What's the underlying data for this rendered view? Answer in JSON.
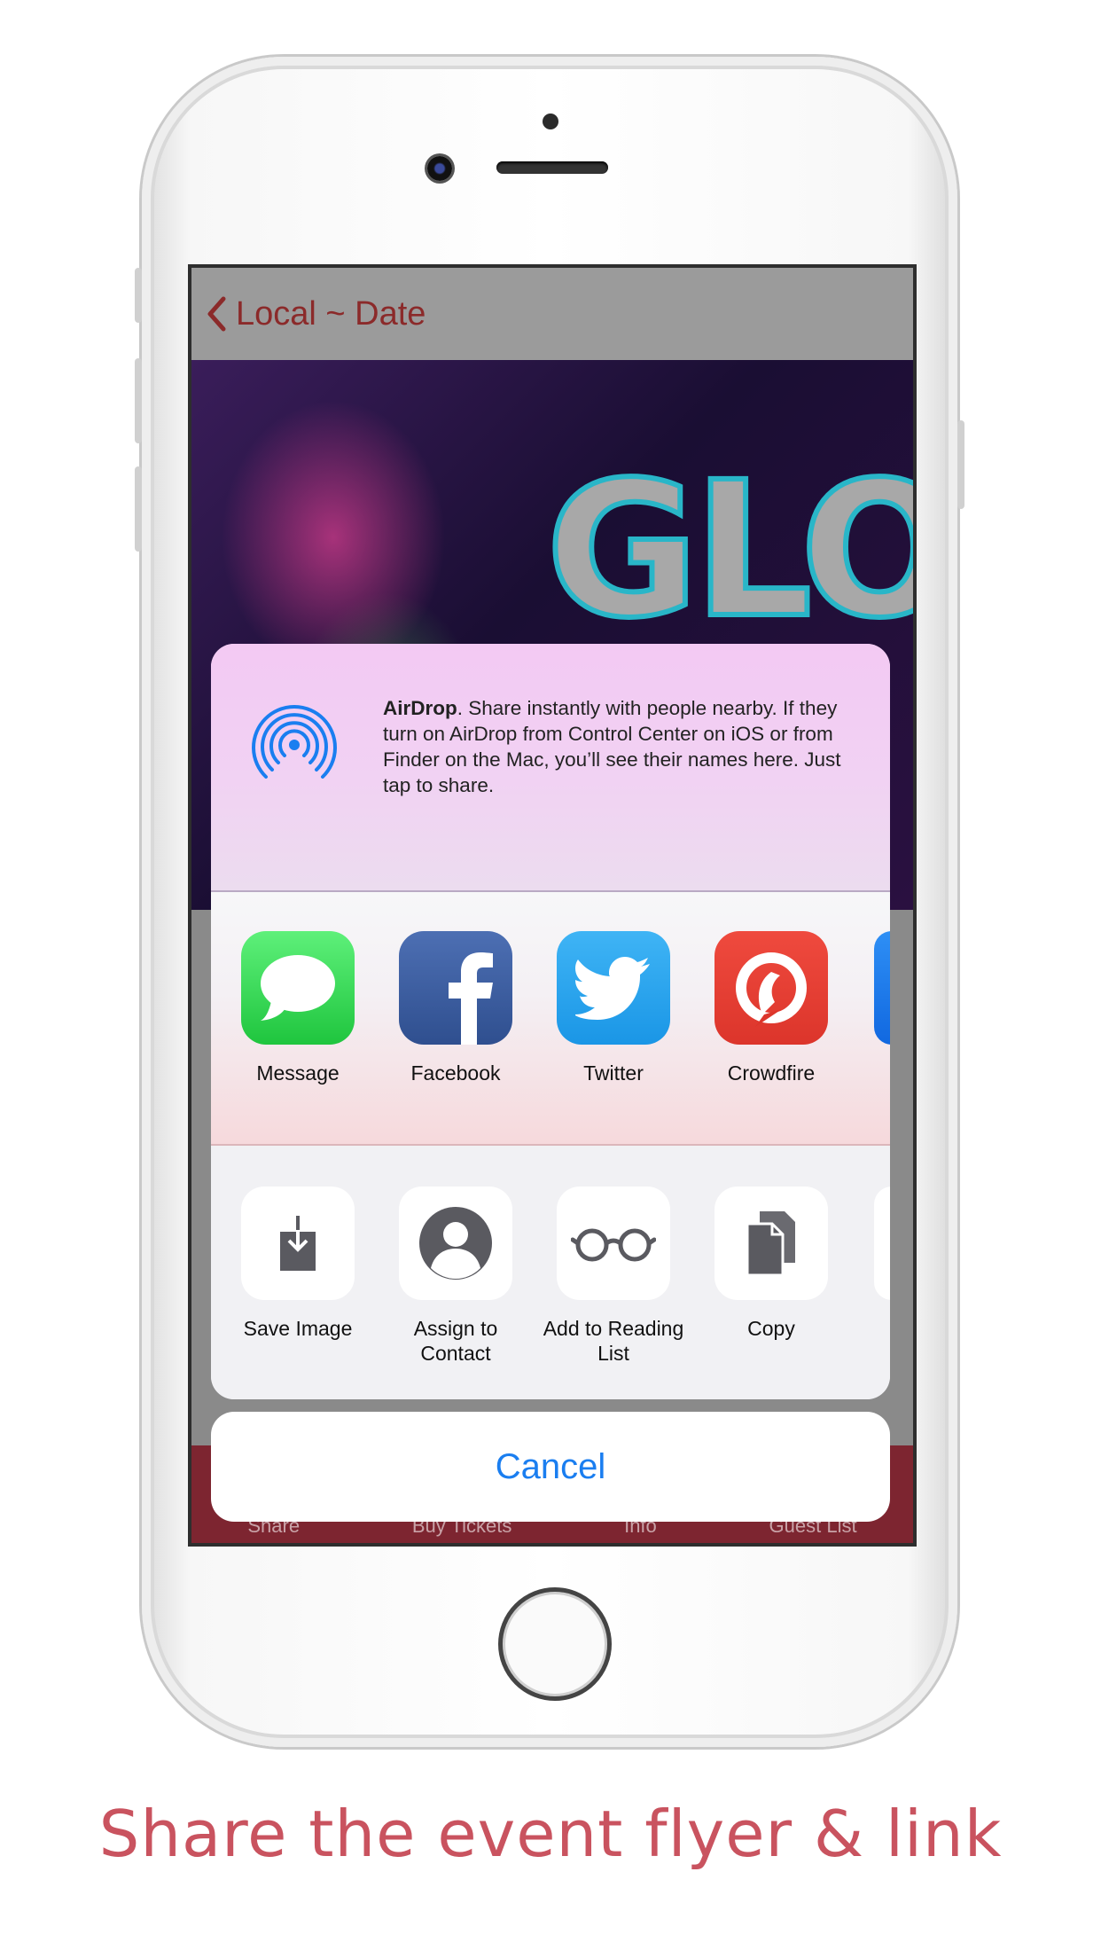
{
  "nav": {
    "back_label": "Local ~ Date"
  },
  "flyer": {
    "title": "GLOW"
  },
  "airdrop": {
    "title": "AirDrop",
    "description": ". Share instantly with people nearby. If they turn on AirDrop from Control Center on iOS or from Finder on the Mac, you’ll see their names here. Just tap to share."
  },
  "apps": [
    {
      "label": "Message",
      "color": "#34c759",
      "icon": "message-icon"
    },
    {
      "label": "Facebook",
      "color": "#3b5998",
      "icon": "facebook-icon"
    },
    {
      "label": "Twitter",
      "color": "#1da1f2",
      "icon": "twitter-icon"
    },
    {
      "label": "Crowdfire",
      "color": "#e8423a",
      "icon": "crowdfire-icon"
    }
  ],
  "actions": [
    {
      "label": "Save Image",
      "icon": "save-image-icon"
    },
    {
      "label": "Assign to Contact",
      "icon": "contact-icon"
    },
    {
      "label": "Add to Reading List",
      "icon": "reading-glasses-icon"
    },
    {
      "label": "Copy",
      "icon": "copy-icon"
    }
  ],
  "cancel_label": "Cancel",
  "tabbar": {
    "share": "Share",
    "buy": "Buy Tickets",
    "info": "Info",
    "guest": "Guest List"
  },
  "headline": "Share the event flyer & link",
  "colors": {
    "accent": "#1a7ef0",
    "headline": "#c9535f",
    "tabbar": "#7d2530"
  }
}
